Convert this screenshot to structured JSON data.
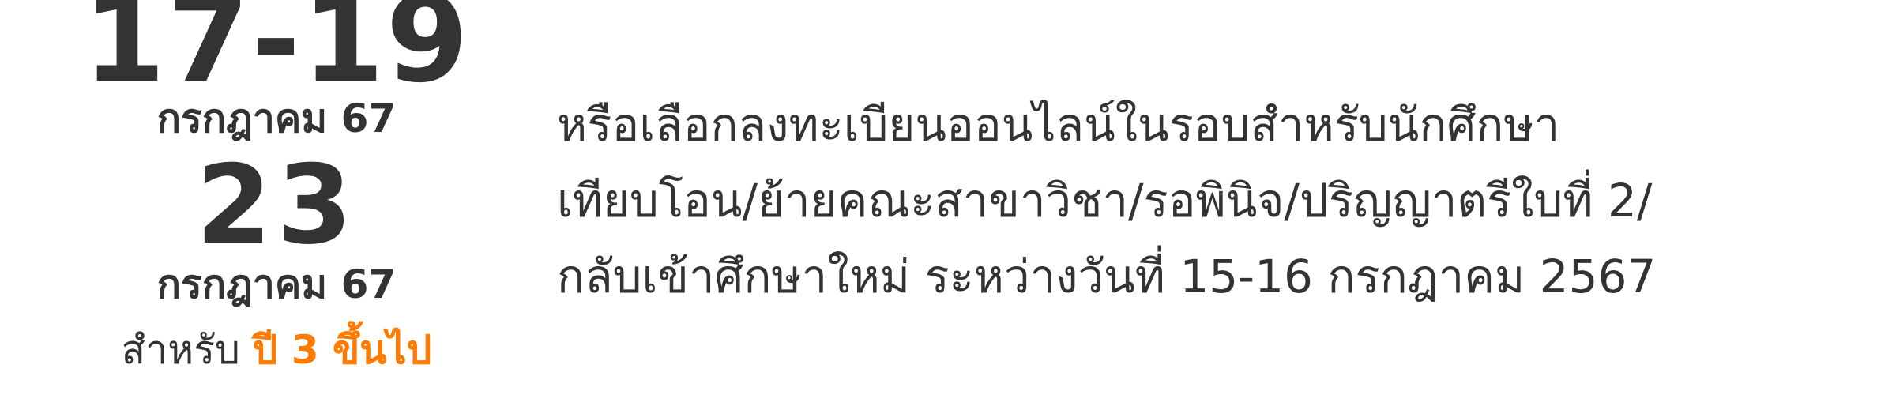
{
  "schedule": {
    "date_range_1": "17-19",
    "month_1": "กรกฎาคม 67",
    "date_2": "23",
    "month_2": "กรกฎาคม 67",
    "for_prefix": "สำหรับ",
    "for_highlight": "ปี 3 ขึ้นไป",
    "highlight_color": "#ff7a00",
    "text_color": "#333333"
  },
  "description": {
    "lines": [
      "หรือเลือกลงทะเบียนออนไลน์ในรอบสำหรับนักศึกษา",
      "เทียบโอน/ย้ายคณะสาขาวิชา/รอพินิจ/ปริญญาตรีใบที่  2/",
      "กลับเข้าศึกษาใหม่ ระหว่างวันที่ 15-16 กรกฎาคม 2567"
    ]
  }
}
